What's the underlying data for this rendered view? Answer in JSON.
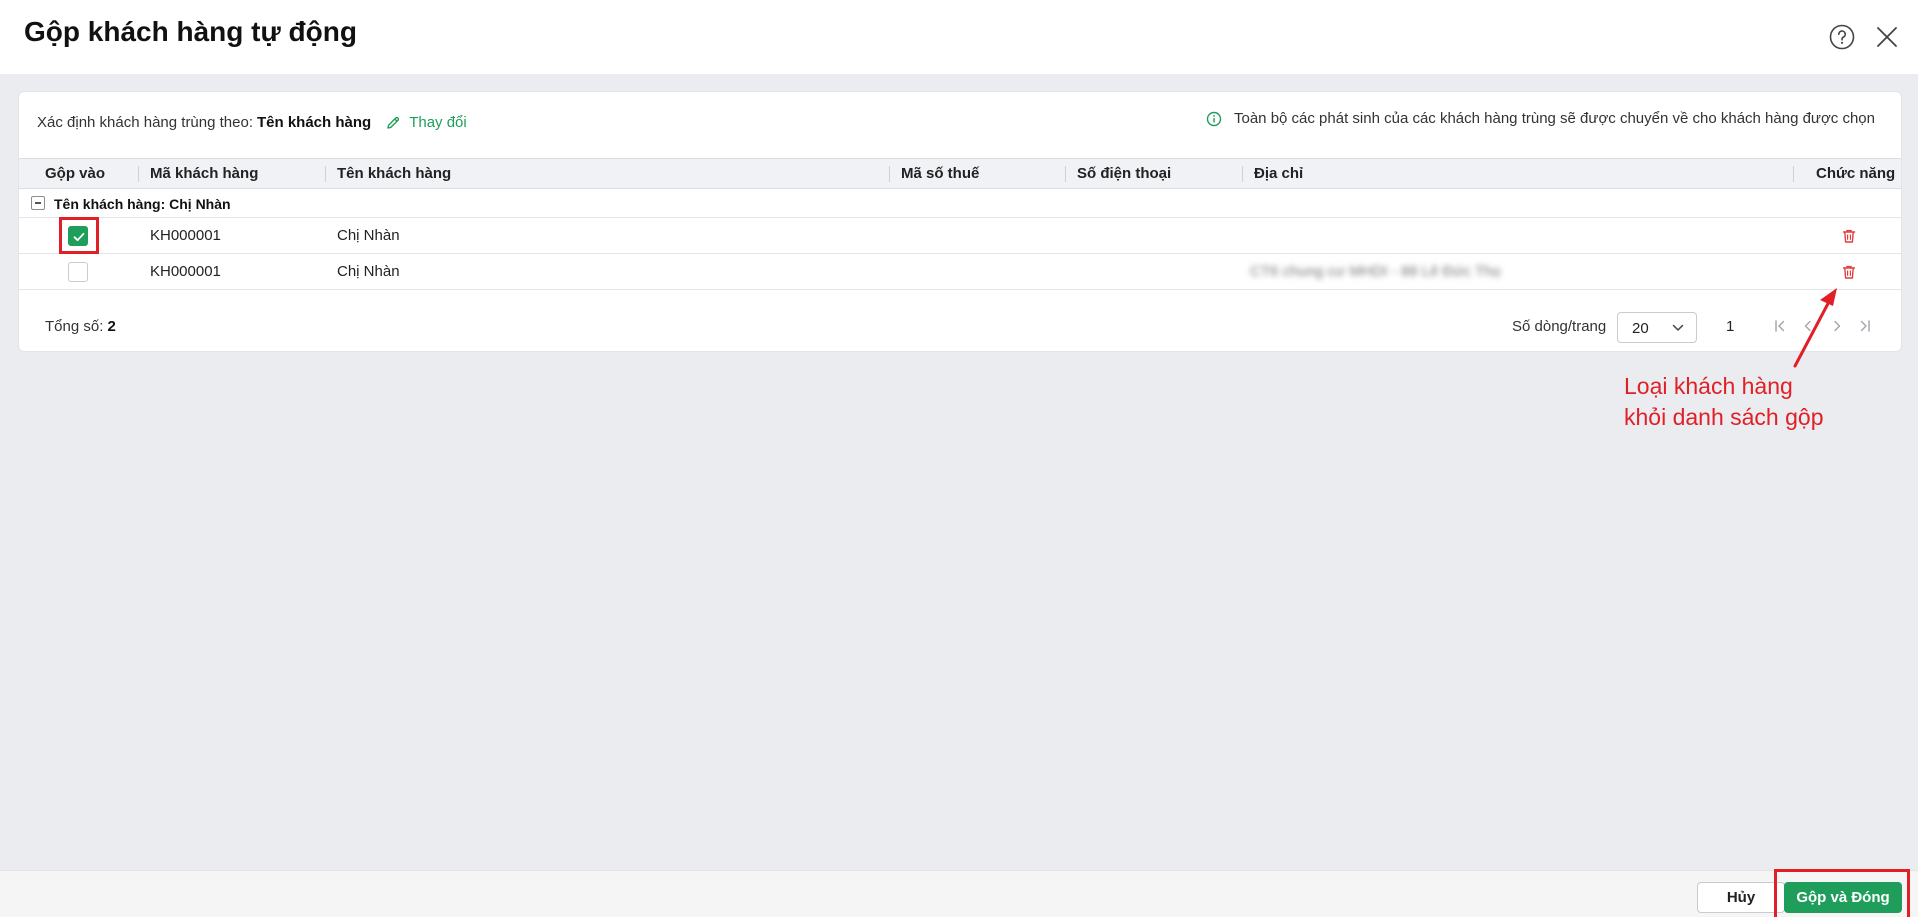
{
  "dialog": {
    "title": "Gộp khách hàng tự động"
  },
  "criteria": {
    "label": "Xác định khách hàng trùng theo:",
    "value": "Tên khách hàng",
    "change_link": "Thay đổi"
  },
  "info": {
    "text": "Toàn bộ các phát sinh của các khách hàng trùng sẽ được chuyển về cho khách hàng được chọn"
  },
  "table": {
    "headers": {
      "merge_into": "Gộp vào",
      "customer_code": "Mã khách hàng",
      "customer_name": "Tên khách hàng",
      "tax_code": "Mã số thuế",
      "phone": "Số điện thoại",
      "address": "Địa chỉ",
      "actions": "Chức năng"
    },
    "group_label": "Tên khách hàng: Chị Nhàn",
    "rows": [
      {
        "checked": true,
        "customer_code": "KH000001",
        "customer_name": "Chị Nhàn",
        "tax_code": "",
        "phone": "",
        "address": ""
      },
      {
        "checked": false,
        "customer_code": "KH000001",
        "customer_name": "Chị Nhàn",
        "tax_code": "",
        "phone": "",
        "address": "CT6 chung cư MHDI - 88 Lê Đức Thọ"
      }
    ]
  },
  "footer": {
    "total_label": "Tổng số:",
    "total_value": "2",
    "rows_per_page_label": "Số dòng/trang",
    "rows_per_page_value": "20",
    "current_page": "1"
  },
  "annotation": {
    "line1": "Loại khách hàng",
    "line2": "khỏi danh sách gộp"
  },
  "buttons": {
    "cancel": "Hủy",
    "merge_close": "Gộp và Đóng"
  },
  "colors": {
    "accent_green": "#1f9e5b",
    "annotation_red": "#e01f26",
    "delete_red": "#e23d3d"
  }
}
